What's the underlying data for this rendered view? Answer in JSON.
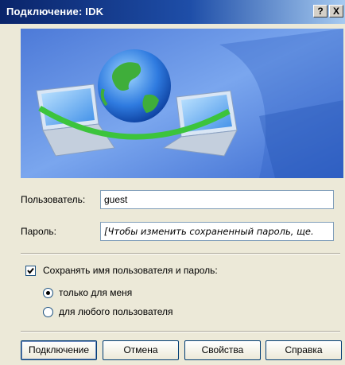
{
  "window": {
    "title": "Подключение: IDK",
    "help_label": "?",
    "close_label": "X"
  },
  "form": {
    "user_label": "Пользователь:",
    "user_value": "guest",
    "password_label": "Пароль:",
    "password_value": "[Чтобы изменить сохраненный пароль, ще."
  },
  "options": {
    "save_label": "Сохранять имя пользователя и пароль:",
    "save_checked": true,
    "only_me_label": "только для меня",
    "anyone_label": "для любого пользователя",
    "selected": "only_me"
  },
  "buttons": {
    "connect": "Подключение",
    "cancel": "Отмена",
    "properties": "Свойства",
    "help": "Справка"
  }
}
